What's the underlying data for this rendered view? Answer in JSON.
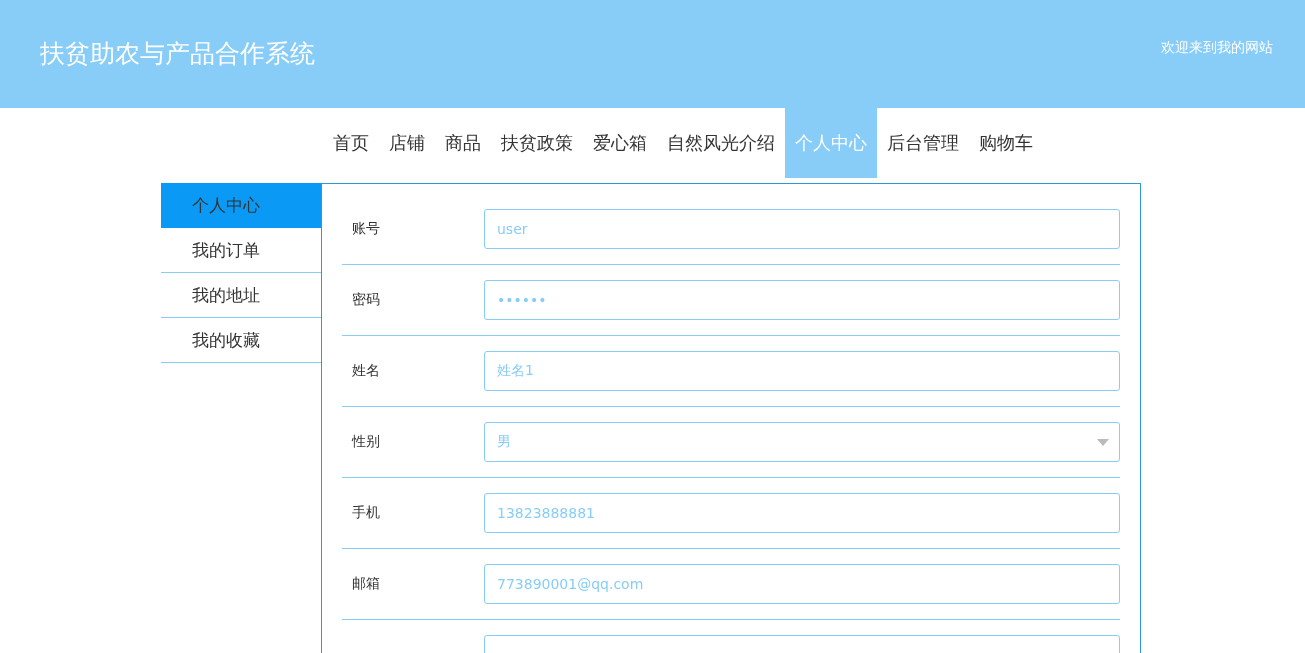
{
  "header": {
    "title": "扶贫助农与产品合作系统",
    "welcome": "欢迎来到我的网站"
  },
  "nav": [
    {
      "label": "首页",
      "selected": false
    },
    {
      "label": "店铺",
      "selected": false
    },
    {
      "label": "商品",
      "selected": false
    },
    {
      "label": "扶贫政策",
      "selected": false
    },
    {
      "label": "爱心箱",
      "selected": false
    },
    {
      "label": "自然风光介绍",
      "selected": false
    },
    {
      "label": "个人中心",
      "selected": true
    },
    {
      "label": "后台管理",
      "selected": false
    },
    {
      "label": "购物车",
      "selected": false
    }
  ],
  "sidebar": {
    "items": [
      {
        "label": "个人中心",
        "selected": true
      },
      {
        "label": "我的订单",
        "selected": false
      },
      {
        "label": "我的地址",
        "selected": false
      },
      {
        "label": "我的收藏",
        "selected": false
      }
    ]
  },
  "form": {
    "fields": [
      {
        "kind": "text",
        "label": "账号",
        "value": "user"
      },
      {
        "kind": "text",
        "label": "密码",
        "value": "••••••"
      },
      {
        "kind": "text",
        "label": "姓名",
        "value": "姓名1"
      },
      {
        "kind": "select",
        "label": "性别",
        "value": "男"
      },
      {
        "kind": "text",
        "label": "手机",
        "value": "13823888881"
      },
      {
        "kind": "text",
        "label": "邮箱",
        "value": "773890001@qq.com"
      },
      {
        "kind": "text"
      }
    ]
  }
}
